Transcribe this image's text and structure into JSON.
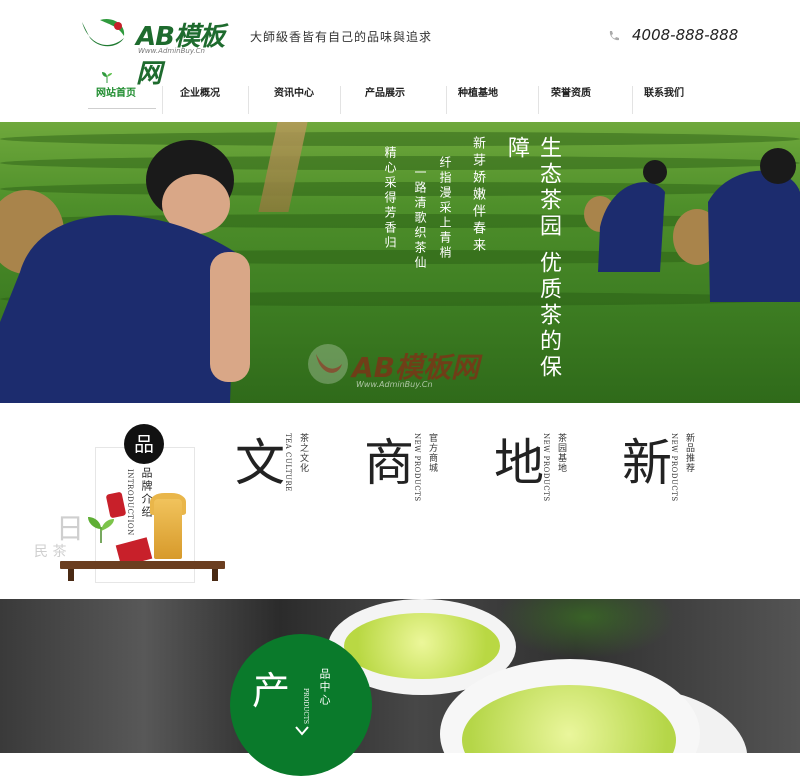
{
  "header": {
    "logo_text": "AB模板网",
    "logo_sub": "Www.AdminBuy.Cn",
    "slogan": "大師級香皆有自己的品味與追求",
    "phone": "4008-888-888"
  },
  "nav": {
    "items": [
      {
        "label": "网站首页",
        "active": true
      },
      {
        "label": "企业概况",
        "active": false
      },
      {
        "label": "资讯中心",
        "active": false
      },
      {
        "label": "产品展示",
        "active": false
      },
      {
        "label": "种植基地",
        "active": false
      },
      {
        "label": "荣誉资质",
        "active": false
      },
      {
        "label": "联系我们",
        "active": false
      }
    ]
  },
  "banner": {
    "title": "生态茶园 优质茶的保障",
    "line1": "新芽娇嫩伴春来",
    "line2": "纤指漫采上青梢",
    "line3": "一路清歌织茶仙",
    "line4": "精心采得芳香归",
    "watermark": "AB模板网",
    "watermark_sub": "Www.AdminBuy.Cn"
  },
  "culture": {
    "badge": "品",
    "title": "品牌介绍",
    "title_en": "INTRODUCTION",
    "faded1": "日",
    "faded2": "民 茶",
    "columns": [
      {
        "char": "文",
        "cn": "茶之文化",
        "en": "TEA CULTURE"
      },
      {
        "char": "商",
        "cn": "官方商城",
        "en": "NEW PRODUCTS"
      },
      {
        "char": "地",
        "cn": "茶园基地",
        "en": "NEW PRODUCTS"
      },
      {
        "char": "新",
        "cn": "新品推荐",
        "en": "NEW PRODUCTS"
      }
    ]
  },
  "products": {
    "char": "产",
    "title": "品中心",
    "title_en": "PRODUCTS"
  },
  "colors": {
    "brand_green": "#0a7a2b",
    "nav_active": "#1e8c2e"
  }
}
